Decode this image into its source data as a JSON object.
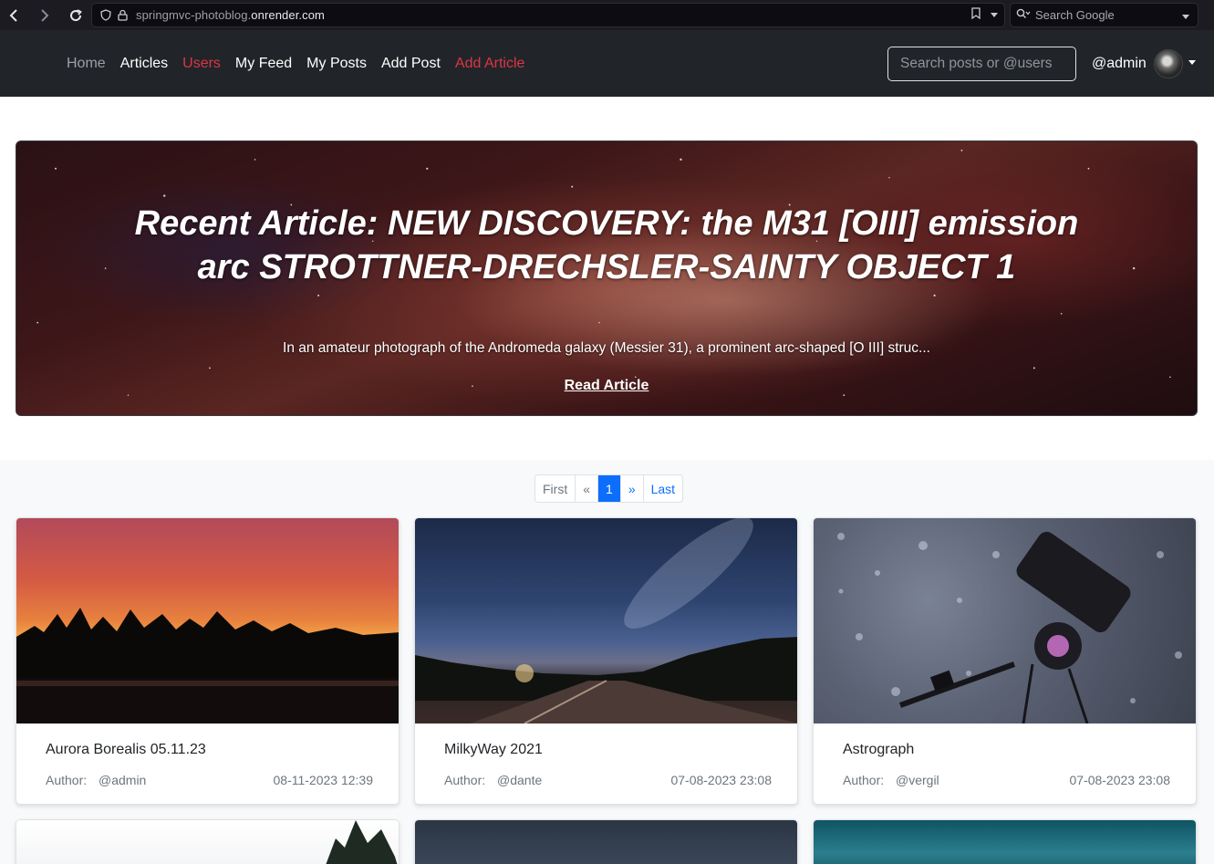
{
  "browser": {
    "url_prefix": "springmvc-photoblog.",
    "url_domain": "onrender.com",
    "search_placeholder": "Search Google"
  },
  "nav": {
    "links": [
      {
        "label": "Home",
        "style": "muted"
      },
      {
        "label": "Articles",
        "style": "normal"
      },
      {
        "label": "Users",
        "style": "red"
      },
      {
        "label": "My Feed",
        "style": "normal"
      },
      {
        "label": "My Posts",
        "style": "normal"
      },
      {
        "label": "Add Post",
        "style": "normal"
      },
      {
        "label": "Add Article",
        "style": "red"
      }
    ],
    "search_placeholder": "Search posts or @users",
    "user_handle": "@admin"
  },
  "hero": {
    "title": "Recent Article: NEW DISCOVERY: the M31 [OIII] emission arc STROTTNER-DRECHSLER-SAINTY OBJECT 1",
    "lead": "In an amateur photograph of the Andromeda galaxy (Messier 31), a prominent arc-shaped [O III] struc...",
    "read_label": "Read Article"
  },
  "pagination": {
    "first": "First",
    "prev": "«",
    "current": "1",
    "next": "»",
    "last": "Last"
  },
  "posts": [
    {
      "title": "Aurora Borealis 05.11.23",
      "author_label": "Author:",
      "author": "@admin",
      "date": "08-11-2023 12:39"
    },
    {
      "title": "MilkyWay 2021",
      "author_label": "Author:",
      "author": "@dante",
      "date": "07-08-2023 23:08"
    },
    {
      "title": "Astrograph",
      "author_label": "Author:",
      "author": "@vergil",
      "date": "07-08-2023 23:08"
    }
  ],
  "colors": {
    "navbar_bg": "#212529",
    "accent_red": "#dc3545",
    "accent_blue": "#0d6efd"
  }
}
